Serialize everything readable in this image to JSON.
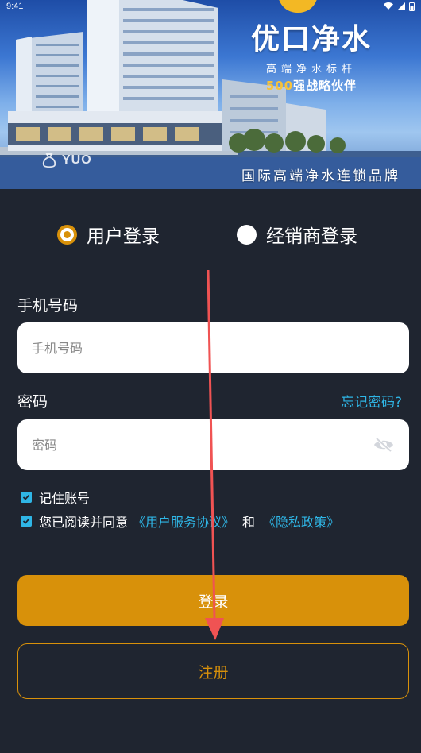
{
  "status_bar": {
    "time": "9:41"
  },
  "banner": {
    "brand_name": "优口净水",
    "tagline": "高端净水标杆",
    "partner_number": "500",
    "partner_text": "强战略伙伴",
    "slogan": "国际高端净水连锁品牌",
    "logo_text": "YUO"
  },
  "login_type": {
    "user_label": "用户登录",
    "dealer_label": "经销商登录",
    "selected": "user"
  },
  "form": {
    "phone_label": "手机号码",
    "phone_placeholder": "手机号码",
    "phone_value": "",
    "password_label": "密码",
    "password_placeholder": "密码",
    "password_value": "",
    "forgot_label": "忘记密码?",
    "remember_label": "记住账号",
    "agree_prefix": "您已阅读并同意",
    "agree_service": "《用户服务协议》",
    "agree_and": "和",
    "agree_privacy": "《隐私政策》"
  },
  "buttons": {
    "login_label": "登录",
    "register_label": "注册"
  },
  "colors": {
    "background": "#1f2530",
    "accent": "#d8910a",
    "link": "#2fb6e6",
    "arrow": "#f05353"
  }
}
